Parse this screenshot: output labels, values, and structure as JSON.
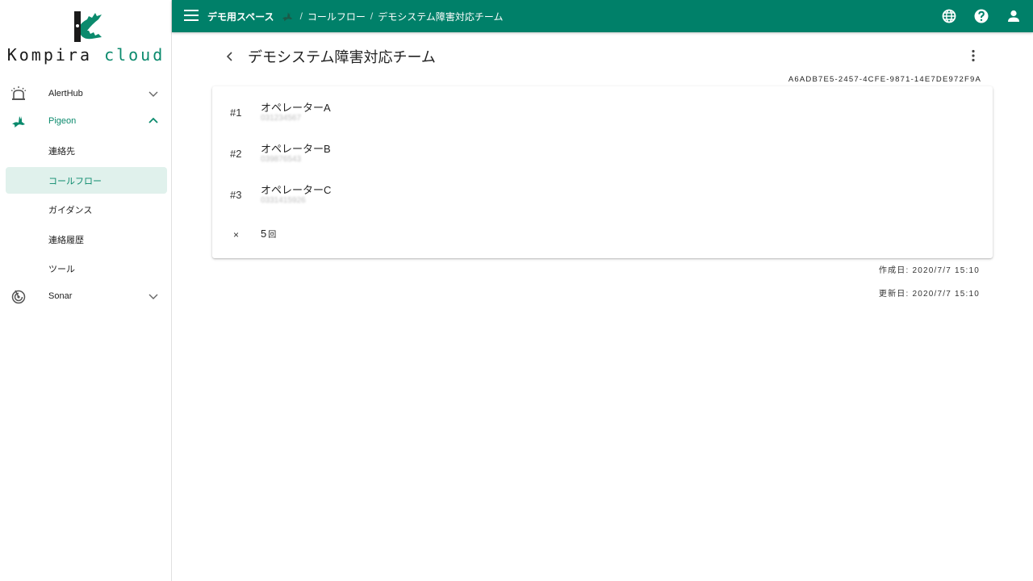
{
  "app": {
    "logo_text_main": "Kompira",
    "logo_text_accent": "cloud",
    "accent_color": "#008069"
  },
  "sidebar": {
    "groups": [
      {
        "label": "AlertHub",
        "icon": "siren-icon",
        "expanded": false
      },
      {
        "label": "Pigeon",
        "icon": "pigeon-icon",
        "expanded": true,
        "items": [
          {
            "label": "連絡先",
            "selected": false
          },
          {
            "label": "コールフロー",
            "selected": true
          },
          {
            "label": "ガイダンス",
            "selected": false
          },
          {
            "label": "連絡履歴",
            "selected": false
          },
          {
            "label": "ツール",
            "selected": false
          }
        ]
      },
      {
        "label": "Sonar",
        "icon": "sonar-icon",
        "expanded": false
      }
    ]
  },
  "topbar": {
    "breadcrumb": {
      "space": "デモ用スペース",
      "separator": "/",
      "section": "コールフロー",
      "current": "デモシステム障害対応チーム"
    },
    "icons": [
      "globe-icon",
      "help-icon",
      "account-icon"
    ]
  },
  "page": {
    "title": "デモシステム障害対応チーム",
    "uuid": "A6ADB7E5-2457-4CFE-9871-14E7DE972F9A",
    "steps": [
      {
        "index": "#1",
        "name": "オペレーターA",
        "phone": "031234567"
      },
      {
        "index": "#2",
        "name": "オペレーターB",
        "phone": "039876543"
      },
      {
        "index": "#3",
        "name": "オペレーターC",
        "phone": "0331415926"
      }
    ],
    "repeat": {
      "symbol": "×",
      "count": "5",
      "unit": "回"
    },
    "created": "作成日: 2020/7/7 15:10",
    "updated": "更新日: 2020/7/7 15:10"
  }
}
